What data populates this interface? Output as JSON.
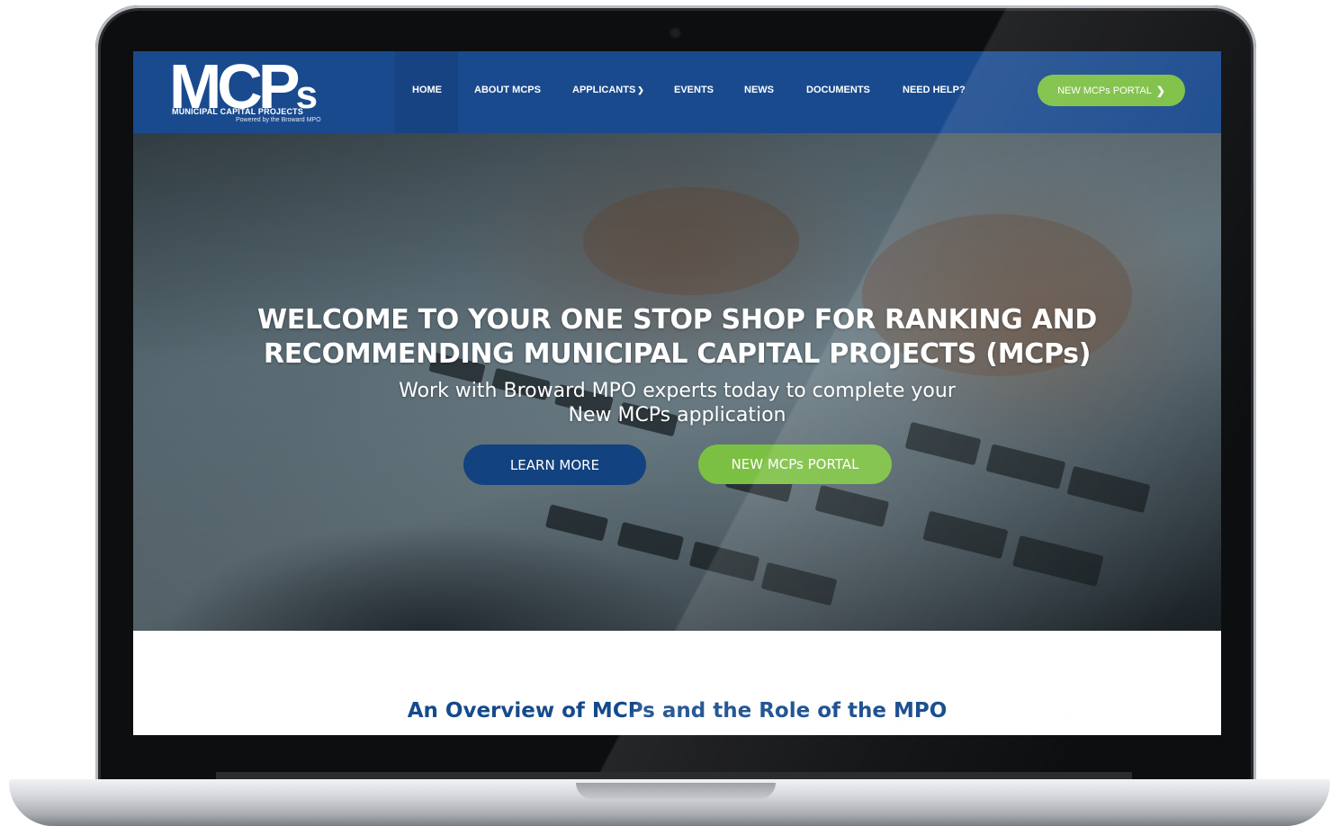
{
  "logo": {
    "main": "MCP",
    "main_s": "s",
    "subtitle": "MUNICIPAL CAPITAL PROJECTS",
    "tagline": "Powered by the Broward MPO"
  },
  "nav": {
    "items": [
      {
        "label": "HOME"
      },
      {
        "label": "ABOUT MCPS"
      },
      {
        "label": "APPLICANTS"
      },
      {
        "label": "EVENTS"
      },
      {
        "label": "NEWS"
      },
      {
        "label": "DOCUMENTS"
      },
      {
        "label": "NEED HELP?"
      }
    ],
    "dropdown_icon": "chevron-down-icon",
    "portal_button": "NEW MCPs PORTAL",
    "portal_icon": "chevron-right-icon"
  },
  "hero": {
    "title_line1": "WELCOME TO YOUR ONE STOP SHOP FOR RANKING AND",
    "title_line2": "RECOMMENDING MUNICIPAL CAPITAL PROJECTS (MCPs)",
    "subtitle_line1": "Work with Broward MPO experts today to complete your",
    "subtitle_line2": "New MCPs application",
    "learn_more": "LEARN MORE",
    "portal_button": "NEW MCPs PORTAL"
  },
  "overview": {
    "title": "An Overview of MCPs and the Role of the MPO"
  },
  "colors": {
    "nav_bg": "#1a4a8e",
    "accent_green": "#7cc043",
    "button_blue": "#12427f",
    "heading_blue": "#154a8c"
  }
}
